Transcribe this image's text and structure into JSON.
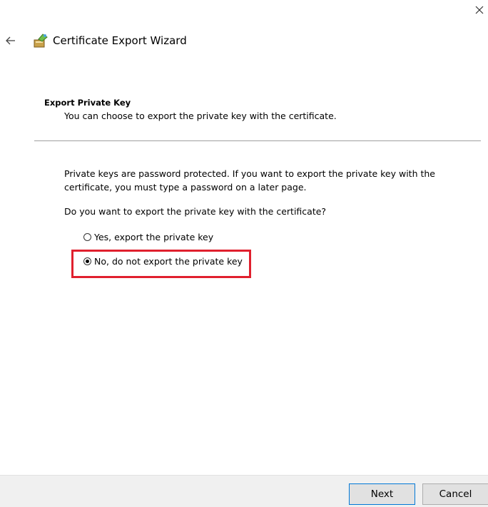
{
  "window": {
    "title": "Certificate Export Wizard",
    "close_icon": "close-icon",
    "back_icon": "back-arrow-icon",
    "wizard_icon": "certificate-wizard-icon"
  },
  "header": {
    "title": "Export Private Key",
    "subtitle": "You can choose to export the private key with the certificate."
  },
  "content": {
    "description": "Private keys are password protected. If you want to export the private key with the certificate, you must type a password on a later page.",
    "question": "Do you want to export the private key with the certificate?",
    "options": [
      {
        "label": "Yes, export the private key",
        "selected": false
      },
      {
        "label": "No, do not export the private key",
        "selected": true
      }
    ],
    "highlight_color": "#e0202e"
  },
  "footer": {
    "next_label": "Next",
    "cancel_label": "Cancel"
  }
}
